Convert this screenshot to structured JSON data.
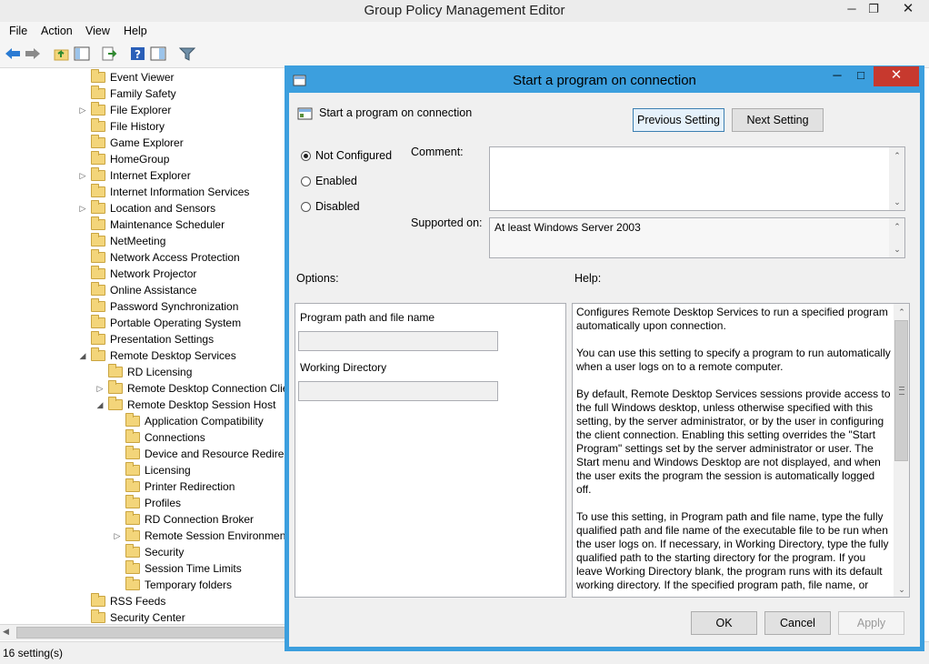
{
  "app": {
    "title": "Group Policy Management Editor"
  },
  "menu": [
    "File",
    "Action",
    "View",
    "Help"
  ],
  "tree": {
    "items": [
      {
        "label": "Event Viewer",
        "level": 0,
        "expander": ""
      },
      {
        "label": "Family Safety",
        "level": 0,
        "expander": ""
      },
      {
        "label": "File Explorer",
        "level": 0,
        "expander": "collapsed"
      },
      {
        "label": "File History",
        "level": 0,
        "expander": ""
      },
      {
        "label": "Game Explorer",
        "level": 0,
        "expander": ""
      },
      {
        "label": "HomeGroup",
        "level": 0,
        "expander": ""
      },
      {
        "label": "Internet Explorer",
        "level": 0,
        "expander": "collapsed"
      },
      {
        "label": "Internet Information Services",
        "level": 0,
        "expander": ""
      },
      {
        "label": "Location and Sensors",
        "level": 0,
        "expander": "collapsed"
      },
      {
        "label": "Maintenance Scheduler",
        "level": 0,
        "expander": ""
      },
      {
        "label": "NetMeeting",
        "level": 0,
        "expander": ""
      },
      {
        "label": "Network Access Protection",
        "level": 0,
        "expander": ""
      },
      {
        "label": "Network Projector",
        "level": 0,
        "expander": ""
      },
      {
        "label": "Online Assistance",
        "level": 0,
        "expander": ""
      },
      {
        "label": "Password Synchronization",
        "level": 0,
        "expander": ""
      },
      {
        "label": "Portable Operating System",
        "level": 0,
        "expander": ""
      },
      {
        "label": "Presentation Settings",
        "level": 0,
        "expander": ""
      },
      {
        "label": "Remote Desktop Services",
        "level": 0,
        "expander": "expanded"
      },
      {
        "label": "RD Licensing",
        "level": 1,
        "expander": ""
      },
      {
        "label": "Remote Desktop Connection Client",
        "level": 1,
        "expander": "collapsed"
      },
      {
        "label": "Remote Desktop Session Host",
        "level": 1,
        "expander": "expanded"
      },
      {
        "label": "Application Compatibility",
        "level": 2,
        "expander": ""
      },
      {
        "label": "Connections",
        "level": 2,
        "expander": ""
      },
      {
        "label": "Device and Resource Redirection",
        "level": 2,
        "expander": ""
      },
      {
        "label": "Licensing",
        "level": 2,
        "expander": ""
      },
      {
        "label": "Printer Redirection",
        "level": 2,
        "expander": ""
      },
      {
        "label": "Profiles",
        "level": 2,
        "expander": ""
      },
      {
        "label": "RD Connection Broker",
        "level": 2,
        "expander": ""
      },
      {
        "label": "Remote Session Environment",
        "level": 2,
        "expander": "collapsed"
      },
      {
        "label": "Security",
        "level": 2,
        "expander": ""
      },
      {
        "label": "Session Time Limits",
        "level": 2,
        "expander": ""
      },
      {
        "label": "Temporary folders",
        "level": 2,
        "expander": ""
      },
      {
        "label": "RSS Feeds",
        "level": 0,
        "expander": ""
      },
      {
        "label": "Security Center",
        "level": 0,
        "expander": ""
      }
    ]
  },
  "status": {
    "text": "16 setting(s)"
  },
  "dialog": {
    "title": "Start a program on connection",
    "setting_name": "Start a program on connection",
    "prev_button": "Previous Setting",
    "next_button": "Next Setting",
    "radios": [
      {
        "label": "Not Configured",
        "checked": true
      },
      {
        "label": "Enabled",
        "checked": false
      },
      {
        "label": "Disabled",
        "checked": false
      }
    ],
    "comment_label": "Comment:",
    "comment_value": "",
    "supported_label": "Supported on:",
    "supported_value": "At least Windows Server 2003",
    "options_label": "Options:",
    "help_label": "Help:",
    "program_path_label": "Program path and file name",
    "program_path_value": "",
    "working_dir_label": "Working Directory",
    "working_dir_value": "",
    "help_paragraphs": [
      "Configures Remote Desktop Services to run a specified program automatically upon connection.",
      "You can use this setting to specify a program to run automatically when a user logs on to a remote computer.",
      "By default, Remote Desktop Services sessions provide access to the full Windows desktop, unless otherwise specified with this setting, by the server administrator, or by the user in configuring the client connection. Enabling this setting overrides the \"Start Program\" settings set by the server administrator or user. The Start menu and Windows Desktop are not displayed, and when the user exits the program the session is automatically logged off.",
      "To use this setting, in Program path and file name, type the fully qualified path and file name of the executable file to be run when the user logs on. If necessary, in Working Directory, type the fully qualified path to the starting directory for the program. If you leave Working Directory blank, the program runs with its default working directory. If the specified program path, file name, or"
    ],
    "ok_button": "OK",
    "cancel_button": "Cancel",
    "apply_button": "Apply"
  },
  "colors": {
    "dialog_border": "#3c9fde",
    "folder": "#f3d57a"
  }
}
